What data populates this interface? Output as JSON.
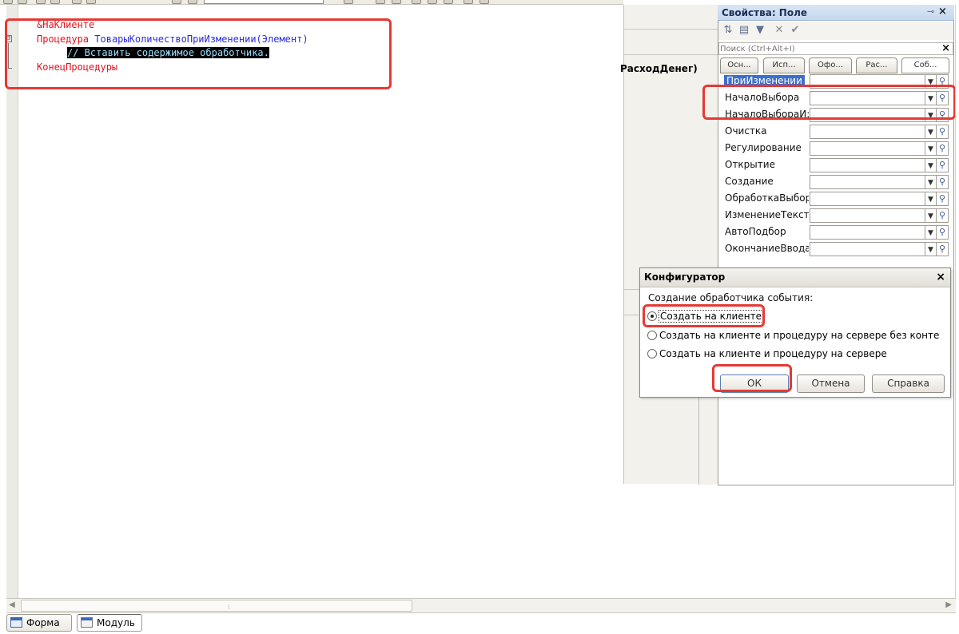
{
  "editor": {
    "lines": [
      "&НаКлиенте",
      "Процедура",
      "ТоварыКоличествоПриИзменении(Элемент)",
      "// Вставить содержимое обработчика.",
      "КонецПроцедуры"
    ],
    "fold_symbol": "⊟"
  },
  "form": {
    "visible_text": "РасходДенег)"
  },
  "properties": {
    "title": "Свойства: Поле",
    "search_placeholder": "Поиск (Ctrl+Alt+I)",
    "tabs": [
      "Осн...",
      "Исп...",
      "Офо...",
      "Рас...",
      "Соб..."
    ],
    "events": [
      "ПриИзменении",
      "НачалоВыбора",
      "НачалоВыбораИ:",
      "Очистка",
      "Регулирование",
      "Открытие",
      "Создание",
      "ОбработкаВыбор",
      "ИзменениеТекст",
      "АвтоПодбор",
      "ОкончаниеВвода"
    ],
    "selected_event": "ПриИзменении"
  },
  "dialog": {
    "title": "Конфигуратор",
    "prompt": "Создание обработчика события:",
    "options": [
      "Создать на клиенте",
      "Создать на клиенте и процедуру на сервере без контекс...",
      "Создать на клиенте и процедуру на сервере"
    ],
    "selected_option": 0,
    "buttons": {
      "ok": "ОК",
      "cancel": "Отмена",
      "help": "Справка"
    }
  },
  "bottom_tabs": [
    "Форма",
    "Модуль"
  ],
  "colors": {
    "highlight_box": "#e53935",
    "keyword": "#e3121f",
    "identifier": "#2b2bd6",
    "selection": "#3d6fc9"
  },
  "icons": {
    "close": "×",
    "dropdown": "▼",
    "magnifier": "🔍"
  }
}
